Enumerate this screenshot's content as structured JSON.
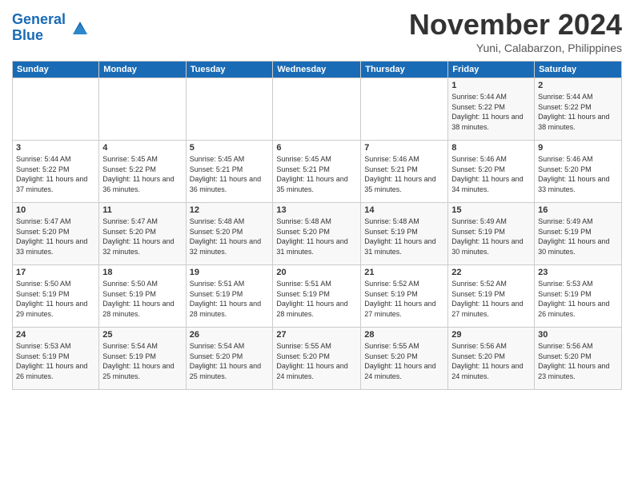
{
  "logo": {
    "line1": "General",
    "line2": "Blue"
  },
  "title": "November 2024",
  "location": "Yuni, Calabarzon, Philippines",
  "weekdays": [
    "Sunday",
    "Monday",
    "Tuesday",
    "Wednesday",
    "Thursday",
    "Friday",
    "Saturday"
  ],
  "weeks": [
    [
      {
        "day": "",
        "sunrise": "",
        "sunset": "",
        "daylight": ""
      },
      {
        "day": "",
        "sunrise": "",
        "sunset": "",
        "daylight": ""
      },
      {
        "day": "",
        "sunrise": "",
        "sunset": "",
        "daylight": ""
      },
      {
        "day": "",
        "sunrise": "",
        "sunset": "",
        "daylight": ""
      },
      {
        "day": "",
        "sunrise": "",
        "sunset": "",
        "daylight": ""
      },
      {
        "day": "1",
        "sunrise": "Sunrise: 5:44 AM",
        "sunset": "Sunset: 5:22 PM",
        "daylight": "Daylight: 11 hours and 38 minutes."
      },
      {
        "day": "2",
        "sunrise": "Sunrise: 5:44 AM",
        "sunset": "Sunset: 5:22 PM",
        "daylight": "Daylight: 11 hours and 38 minutes."
      }
    ],
    [
      {
        "day": "3",
        "sunrise": "Sunrise: 5:44 AM",
        "sunset": "Sunset: 5:22 PM",
        "daylight": "Daylight: 11 hours and 37 minutes."
      },
      {
        "day": "4",
        "sunrise": "Sunrise: 5:45 AM",
        "sunset": "Sunset: 5:22 PM",
        "daylight": "Daylight: 11 hours and 36 minutes."
      },
      {
        "day": "5",
        "sunrise": "Sunrise: 5:45 AM",
        "sunset": "Sunset: 5:21 PM",
        "daylight": "Daylight: 11 hours and 36 minutes."
      },
      {
        "day": "6",
        "sunrise": "Sunrise: 5:45 AM",
        "sunset": "Sunset: 5:21 PM",
        "daylight": "Daylight: 11 hours and 35 minutes."
      },
      {
        "day": "7",
        "sunrise": "Sunrise: 5:46 AM",
        "sunset": "Sunset: 5:21 PM",
        "daylight": "Daylight: 11 hours and 35 minutes."
      },
      {
        "day": "8",
        "sunrise": "Sunrise: 5:46 AM",
        "sunset": "Sunset: 5:20 PM",
        "daylight": "Daylight: 11 hours and 34 minutes."
      },
      {
        "day": "9",
        "sunrise": "Sunrise: 5:46 AM",
        "sunset": "Sunset: 5:20 PM",
        "daylight": "Daylight: 11 hours and 33 minutes."
      }
    ],
    [
      {
        "day": "10",
        "sunrise": "Sunrise: 5:47 AM",
        "sunset": "Sunset: 5:20 PM",
        "daylight": "Daylight: 11 hours and 33 minutes."
      },
      {
        "day": "11",
        "sunrise": "Sunrise: 5:47 AM",
        "sunset": "Sunset: 5:20 PM",
        "daylight": "Daylight: 11 hours and 32 minutes."
      },
      {
        "day": "12",
        "sunrise": "Sunrise: 5:48 AM",
        "sunset": "Sunset: 5:20 PM",
        "daylight": "Daylight: 11 hours and 32 minutes."
      },
      {
        "day": "13",
        "sunrise": "Sunrise: 5:48 AM",
        "sunset": "Sunset: 5:20 PM",
        "daylight": "Daylight: 11 hours and 31 minutes."
      },
      {
        "day": "14",
        "sunrise": "Sunrise: 5:48 AM",
        "sunset": "Sunset: 5:19 PM",
        "daylight": "Daylight: 11 hours and 31 minutes."
      },
      {
        "day": "15",
        "sunrise": "Sunrise: 5:49 AM",
        "sunset": "Sunset: 5:19 PM",
        "daylight": "Daylight: 11 hours and 30 minutes."
      },
      {
        "day": "16",
        "sunrise": "Sunrise: 5:49 AM",
        "sunset": "Sunset: 5:19 PM",
        "daylight": "Daylight: 11 hours and 30 minutes."
      }
    ],
    [
      {
        "day": "17",
        "sunrise": "Sunrise: 5:50 AM",
        "sunset": "Sunset: 5:19 PM",
        "daylight": "Daylight: 11 hours and 29 minutes."
      },
      {
        "day": "18",
        "sunrise": "Sunrise: 5:50 AM",
        "sunset": "Sunset: 5:19 PM",
        "daylight": "Daylight: 11 hours and 28 minutes."
      },
      {
        "day": "19",
        "sunrise": "Sunrise: 5:51 AM",
        "sunset": "Sunset: 5:19 PM",
        "daylight": "Daylight: 11 hours and 28 minutes."
      },
      {
        "day": "20",
        "sunrise": "Sunrise: 5:51 AM",
        "sunset": "Sunset: 5:19 PM",
        "daylight": "Daylight: 11 hours and 28 minutes."
      },
      {
        "day": "21",
        "sunrise": "Sunrise: 5:52 AM",
        "sunset": "Sunset: 5:19 PM",
        "daylight": "Daylight: 11 hours and 27 minutes."
      },
      {
        "day": "22",
        "sunrise": "Sunrise: 5:52 AM",
        "sunset": "Sunset: 5:19 PM",
        "daylight": "Daylight: 11 hours and 27 minutes."
      },
      {
        "day": "23",
        "sunrise": "Sunrise: 5:53 AM",
        "sunset": "Sunset: 5:19 PM",
        "daylight": "Daylight: 11 hours and 26 minutes."
      }
    ],
    [
      {
        "day": "24",
        "sunrise": "Sunrise: 5:53 AM",
        "sunset": "Sunset: 5:19 PM",
        "daylight": "Daylight: 11 hours and 26 minutes."
      },
      {
        "day": "25",
        "sunrise": "Sunrise: 5:54 AM",
        "sunset": "Sunset: 5:19 PM",
        "daylight": "Daylight: 11 hours and 25 minutes."
      },
      {
        "day": "26",
        "sunrise": "Sunrise: 5:54 AM",
        "sunset": "Sunset: 5:20 PM",
        "daylight": "Daylight: 11 hours and 25 minutes."
      },
      {
        "day": "27",
        "sunrise": "Sunrise: 5:55 AM",
        "sunset": "Sunset: 5:20 PM",
        "daylight": "Daylight: 11 hours and 24 minutes."
      },
      {
        "day": "28",
        "sunrise": "Sunrise: 5:55 AM",
        "sunset": "Sunset: 5:20 PM",
        "daylight": "Daylight: 11 hours and 24 minutes."
      },
      {
        "day": "29",
        "sunrise": "Sunrise: 5:56 AM",
        "sunset": "Sunset: 5:20 PM",
        "daylight": "Daylight: 11 hours and 24 minutes."
      },
      {
        "day": "30",
        "sunrise": "Sunrise: 5:56 AM",
        "sunset": "Sunset: 5:20 PM",
        "daylight": "Daylight: 11 hours and 23 minutes."
      }
    ]
  ]
}
